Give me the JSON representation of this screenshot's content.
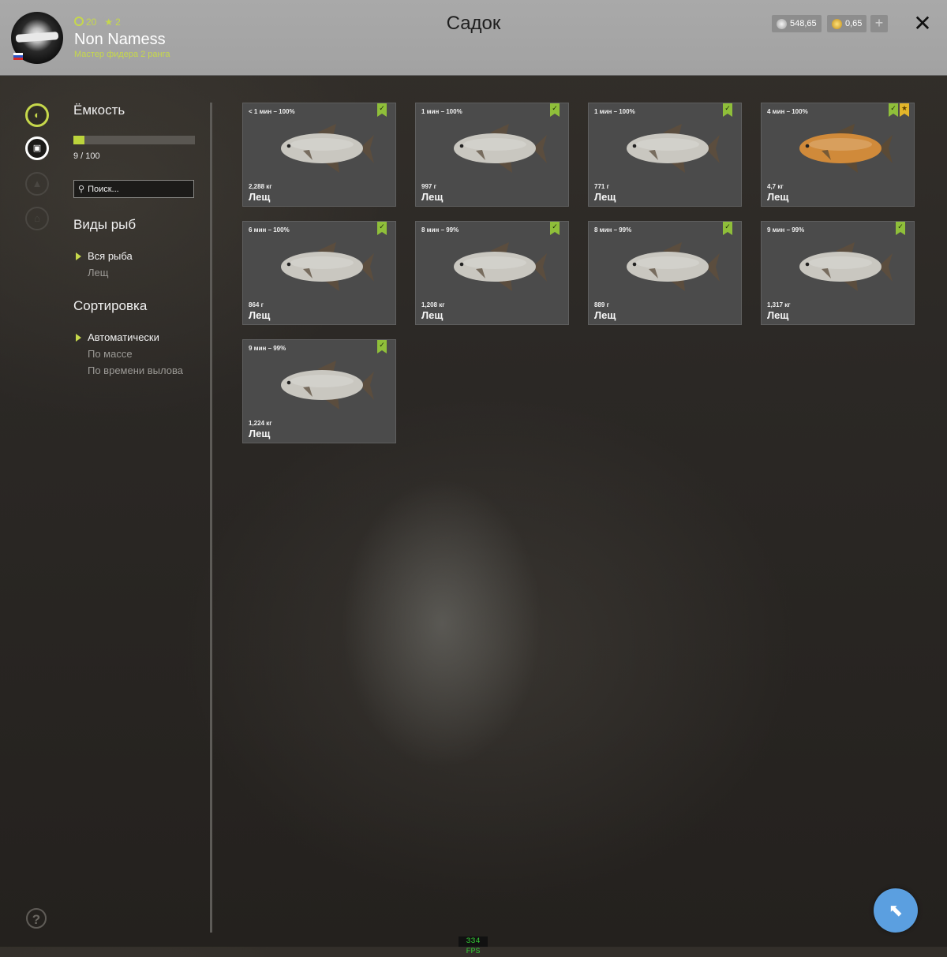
{
  "header": {
    "title": "Садок",
    "player_name": "Non Namess",
    "player_rank": "Мастер фидера 2 ранга",
    "level": "20",
    "stars": "2",
    "silver": "548,65",
    "gold": "0,65",
    "plus": "+",
    "close": "✕"
  },
  "sidebar": {
    "capacity_title": "Ёмкость",
    "capacity_count": "9 / 100",
    "capacity_fraction": 0.09,
    "search_placeholder": "Поиск...",
    "species_title": "Виды рыб",
    "species": [
      "Вся рыба",
      "Лещ"
    ],
    "sort_title": "Сортировка",
    "sort_options": [
      "Автоматически",
      "По массе",
      "По времени вылова"
    ],
    "help": "?"
  },
  "fish": [
    {
      "time": "< 1 мин – 100%",
      "weight": "2,288 кг",
      "name": "Лещ",
      "trophy": false
    },
    {
      "time": "1 мин – 100%",
      "weight": "997 г",
      "name": "Лещ",
      "trophy": false
    },
    {
      "time": "1 мин – 100%",
      "weight": "771 г",
      "name": "Лещ",
      "trophy": false
    },
    {
      "time": "4 мин – 100%",
      "weight": "4,7 кг",
      "name": "Лещ",
      "trophy": true
    },
    {
      "time": "6 мин – 100%",
      "weight": "864 г",
      "name": "Лещ",
      "trophy": false
    },
    {
      "time": "8 мин – 99%",
      "weight": "1,208 кг",
      "name": "Лещ",
      "trophy": false
    },
    {
      "time": "8 мин – 99%",
      "weight": "889 г",
      "name": "Лещ",
      "trophy": false
    },
    {
      "time": "9 мин – 99%",
      "weight": "1,317 кг",
      "name": "Лещ",
      "trophy": false
    },
    {
      "time": "9 мин – 99%",
      "weight": "1,224 кг",
      "name": "Лещ",
      "trophy": false
    }
  ],
  "fps": "334 FPS",
  "colors": {
    "accent": "#c6d84b",
    "badge_green": "#8fbf3a",
    "badge_yellow": "#e2b52a",
    "card_bg": "#4b4b4b",
    "fish_silver": "#c9c7c0",
    "fish_gold": "#d08a3a"
  }
}
